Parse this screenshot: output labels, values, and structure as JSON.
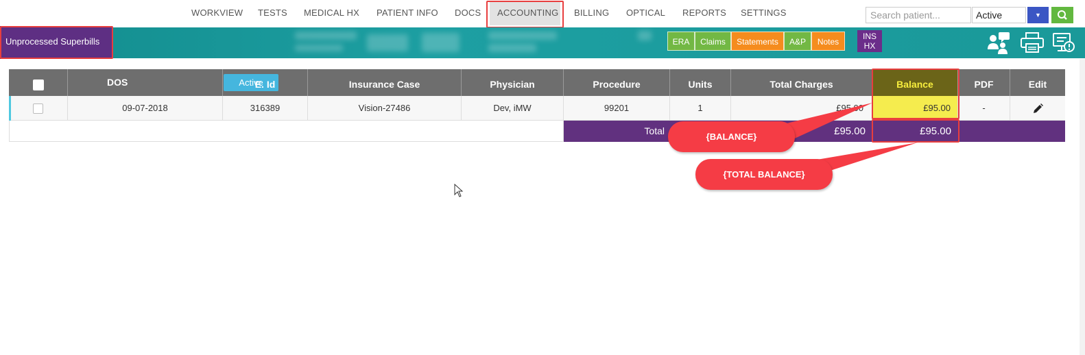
{
  "nav": {
    "items": [
      "WORKVIEW",
      "TESTS",
      "MEDICAL HX",
      "PATIENT INFO",
      "DOCS",
      "ACCOUNTING",
      "BILLING",
      "OPTICAL",
      "REPORTS",
      "SETTINGS"
    ],
    "active": "ACCOUNTING"
  },
  "search": {
    "placeholder": "Search patient...",
    "status_value": "Active"
  },
  "subheader": {
    "title": "Unprocessed Superbills",
    "buttons": [
      "ERA",
      "Claims",
      "Statements",
      "A&P",
      "Notes"
    ],
    "ins_hx_line1": "INS",
    "ins_hx_line2": "HX"
  },
  "table": {
    "headers": {
      "dos": "DOS",
      "dos_badge": "Active",
      "eid": "E. Id",
      "insurance_case": "Insurance Case",
      "physician": "Physician",
      "procedure": "Procedure",
      "units": "Units",
      "total_charges": "Total Charges",
      "balance": "Balance",
      "pdf": "PDF",
      "edit": "Edit"
    },
    "rows": [
      {
        "dos": "09-07-2018",
        "eid": "316389",
        "insurance_case": "Vision-27486",
        "physician": "Dev, iMW",
        "procedure": "99201",
        "units": "1",
        "total_charges": "£95.00",
        "balance": "£95.00",
        "pdf": "-"
      }
    ],
    "totals": {
      "label": "Total",
      "total_charges": "£95.00",
      "balance": "£95.00"
    }
  },
  "callouts": {
    "balance": "{BALANCE}",
    "total_balance": "{TOTAL BALANCE}"
  },
  "colors": {
    "teal": "#1a9999",
    "purple": "#5e2f83",
    "green": "#72b844",
    "orange": "#f58c1e",
    "balance_highlight": "#f5ec4e",
    "callout_red": "#f53c45"
  }
}
